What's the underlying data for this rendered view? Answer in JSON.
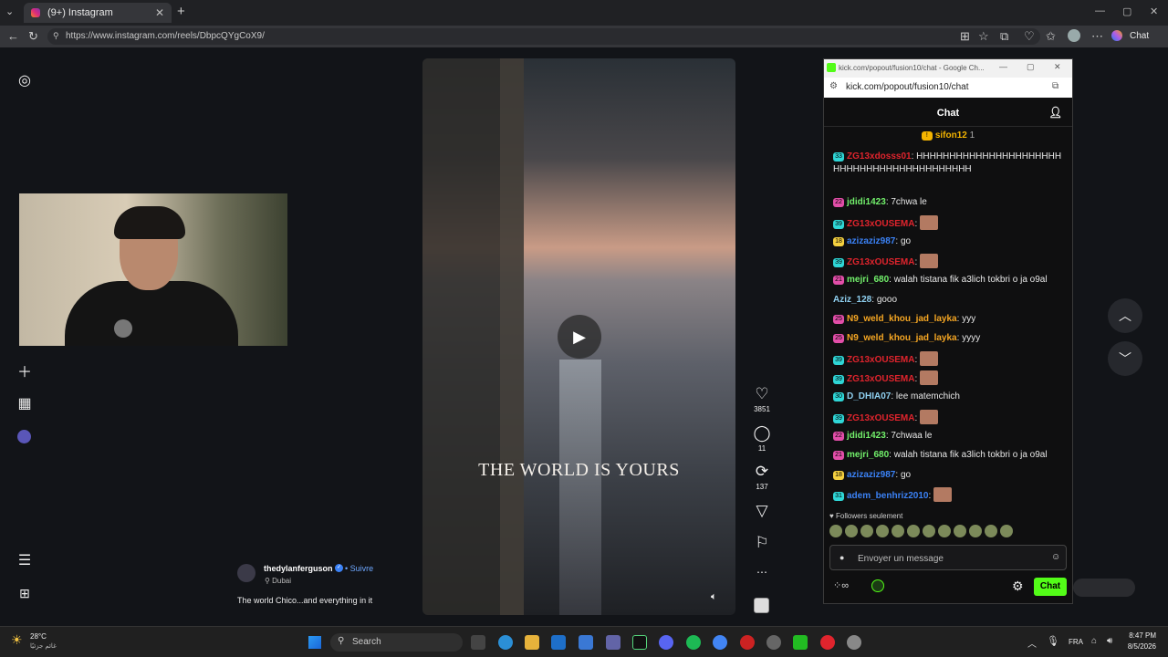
{
  "browser": {
    "tab_title": "(9+) Instagram",
    "url": "https://www.instagram.com/reels/DbpcQYgCoX9/",
    "copilot_label": "Chat"
  },
  "reel": {
    "caption_overlay": "THE WORLD IS YOURS",
    "username": "thedylanferguson",
    "follow_label": "Suivre",
    "location": "Dubai",
    "description": "The world Chico...and everything in it",
    "likes": "3851",
    "comments": "11",
    "reposts": "137"
  },
  "chat_window": {
    "title": "kick.com/popout/fusion10/chat - Google Ch...",
    "url": "kick.com/popout/fusion10/chat",
    "header": "Chat",
    "pinned_user": "sifon12",
    "pinned_count": "1",
    "messages": [
      {
        "badge": "33",
        "badge_color": "#2fd6d6",
        "user": "ZG13xdosss01",
        "user_color": "#e0242d",
        "text": "HHHHHHHHHHHHHHHHHHHHHHHHHHHHHHHHHHHHHHHHHHH",
        "emote": false
      },
      {
        "badge": "22",
        "badge_color": "#e24ea8",
        "user": "jdidi1423",
        "user_color": "#72f06b",
        "text": "7chwa le",
        "emote": false
      },
      {
        "badge": "39",
        "badge_color": "#2fd6d6",
        "user": "ZG13xOUSEMA",
        "user_color": "#e0242d",
        "text": "",
        "emote": true
      },
      {
        "badge": "18",
        "badge_color": "#f4d03f",
        "user": "azizaziz987",
        "user_color": "#3b82f6",
        "text": "go",
        "emote": false
      },
      {
        "badge": "39",
        "badge_color": "#2fd6d6",
        "user": "ZG13xOUSEMA",
        "user_color": "#e0242d",
        "text": "",
        "emote": true
      },
      {
        "badge": "21",
        "badge_color": "#e24ea8",
        "user": "mejri_680",
        "user_color": "#72f06b",
        "text": "walah tistana fik a3lich tokbri o ja o9al",
        "emote": false
      },
      {
        "badge": "",
        "badge_color": "",
        "user": "Aziz_128",
        "user_color": "#8fd0f0",
        "text": "gooo",
        "emote": false
      },
      {
        "badge": "25",
        "badge_color": "#e24ea8",
        "user": "N9_weld_khou_jad_layka",
        "user_color": "#f5a623",
        "text": "yyy",
        "emote": false
      },
      {
        "badge": "25",
        "badge_color": "#e24ea8",
        "user": "N9_weld_khou_jad_layka",
        "user_color": "#f5a623",
        "text": "yyyy",
        "emote": false
      },
      {
        "badge": "39",
        "badge_color": "#2fd6d6",
        "user": "ZG13xOUSEMA",
        "user_color": "#e0242d",
        "text": "",
        "emote": true
      },
      {
        "badge": "39",
        "badge_color": "#2fd6d6",
        "user": "ZG13xOUSEMA",
        "user_color": "#e0242d",
        "text": "",
        "emote": true
      },
      {
        "badge": "30",
        "badge_color": "#2fd6d6",
        "user": "D_DHIA07",
        "user_color": "#8fd0f0",
        "text": "lee matemchich",
        "emote": false
      },
      {
        "badge": "39",
        "badge_color": "#2fd6d6",
        "user": "ZG13xOUSEMA",
        "user_color": "#e0242d",
        "text": "",
        "emote": true
      },
      {
        "badge": "22",
        "badge_color": "#e24ea8",
        "user": "jdidi1423",
        "user_color": "#72f06b",
        "text": "7chwaa le",
        "emote": false
      },
      {
        "badge": "21",
        "badge_color": "#e24ea8",
        "user": "mejri_680",
        "user_color": "#72f06b",
        "text": "walah tistana fik a3lich tokbri o ja o9al",
        "emote": false
      },
      {
        "badge": "18",
        "badge_color": "#f4d03f",
        "user": "azizaziz987",
        "user_color": "#3b82f6",
        "text": "go",
        "emote": false
      },
      {
        "badge": "31",
        "badge_color": "#2fd6d6",
        "user": "adem_benhriz2010",
        "user_color": "#3b82f6",
        "text": "",
        "emote": true
      }
    ],
    "followers_label": "Followers seulement",
    "input_placeholder": "Envoyer un message",
    "chat_button": "Chat"
  },
  "taskbar": {
    "weather_temp": "28°C",
    "weather_desc": "غائم جزئيًا",
    "search_label": "Search",
    "language": "FRA",
    "time": "8:47 PM",
    "date": "8/5/2026"
  }
}
